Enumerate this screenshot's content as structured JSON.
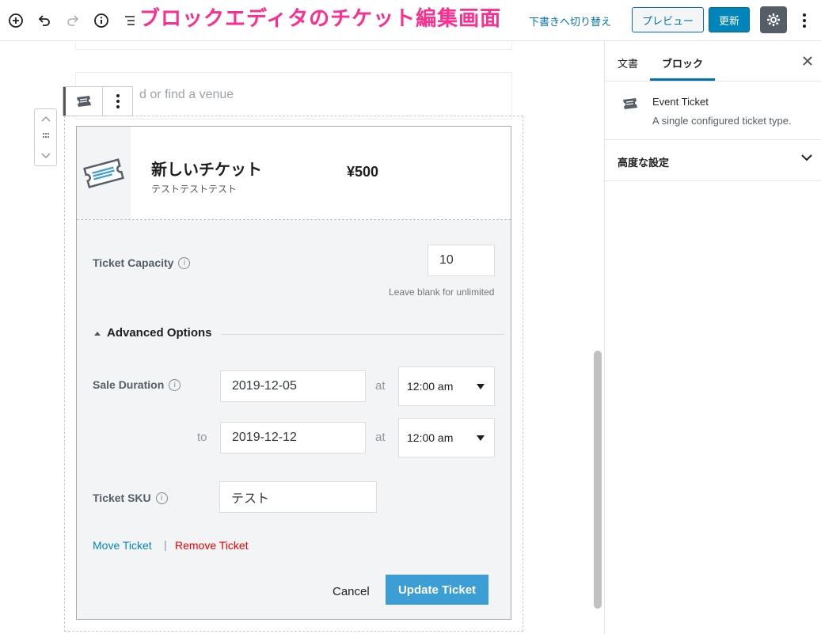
{
  "overlay_title": "ブロックエディタのチケット編集画面",
  "topbar": {
    "draft_label": "下書きへ切り替え",
    "preview_label": "プレビュー",
    "update_label": "更新"
  },
  "editor": {
    "venue_placeholder": "d or find a venue",
    "ticket": {
      "title": "新しいチケット",
      "description": "テストテストテスト",
      "price": "¥500",
      "capacity_label": "Ticket Capacity",
      "capacity_value": "10",
      "capacity_hint": "Leave blank for unlimited",
      "advanced_label": "Advanced Options",
      "sale_duration_label": "Sale Duration",
      "start_date": "2019-12-05",
      "start_time": "12:00 am",
      "end_date": "2019-12-12",
      "end_time": "12:00 am",
      "at_label": "at",
      "to_label": "to",
      "sku_label": "Ticket SKU",
      "sku_value": "テスト",
      "move_label": "Move Ticket",
      "separator": "|",
      "remove_label": "Remove Ticket",
      "cancel_label": "Cancel",
      "update_label": "Update Ticket"
    }
  },
  "sidebar": {
    "tab_document": "文書",
    "tab_block": "ブロック",
    "block_title": "Event Ticket",
    "block_desc": "A single configured ticket type.",
    "advanced_title": "高度な設定"
  },
  "colors": {
    "accent": "#0073aa",
    "update_ticket": "#3d9ed6",
    "remove": "#e00000",
    "overlay": "#ff2d8e"
  }
}
